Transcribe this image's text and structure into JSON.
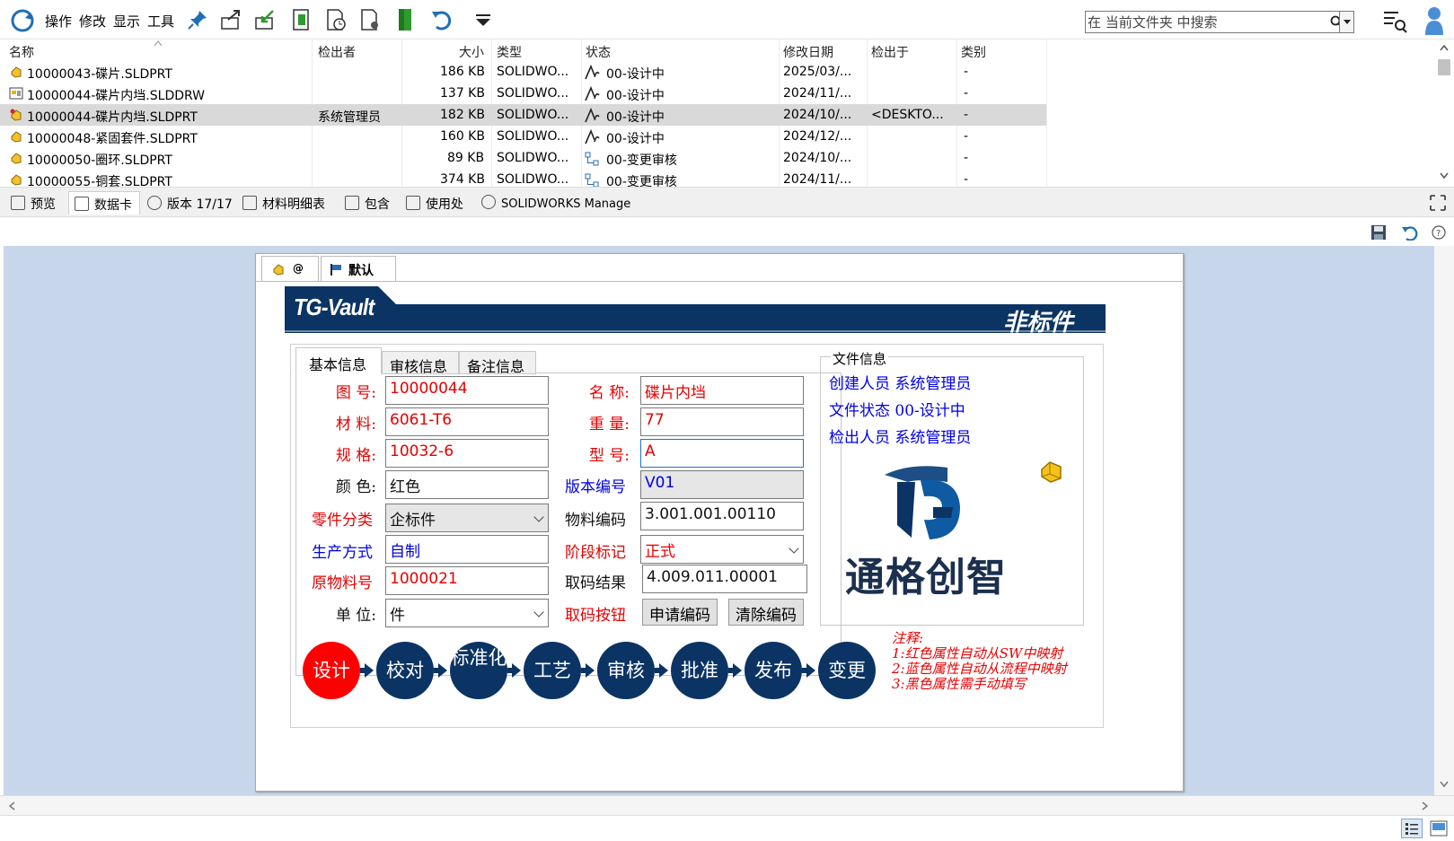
{
  "toolbar": {
    "menus": [
      "操作",
      "修改",
      "显示",
      "工具"
    ],
    "search_placeholder": "在 当前文件夹 中搜索"
  },
  "file_list": {
    "columns": [
      "名称",
      "检出者",
      "大小",
      "类型",
      "状态",
      "修改日期",
      "检出于",
      "类别"
    ],
    "rows": [
      {
        "name": "10000043-碟片.SLDPRT",
        "checked_out_by": "",
        "size": "186 KB",
        "type": "SOLIDWO...",
        "state": "00-设计中",
        "modified": "2025/03/...",
        "checked_out_in": "",
        "category": "-"
      },
      {
        "name": "10000044-碟片内垱.SLDDRW",
        "checked_out_by": "",
        "size": "137 KB",
        "type": "SOLIDWO...",
        "state": "00-设计中",
        "modified": "2024/11/...",
        "checked_out_in": "",
        "category": "-"
      },
      {
        "name": "10000044-碟片内垱.SLDPRT",
        "checked_out_by": "系统管理员",
        "size": "182 KB",
        "type": "SOLIDWO...",
        "state": "00-设计中",
        "modified": "2024/10/...",
        "checked_out_in": "<DESKTO...",
        "category": "-"
      },
      {
        "name": "10000048-紧固套件.SLDPRT",
        "checked_out_by": "",
        "size": "160 KB",
        "type": "SOLIDWO...",
        "state": "00-设计中",
        "modified": "2024/12/...",
        "checked_out_in": "",
        "category": "-"
      },
      {
        "name": "10000050-圈环.SLDPRT",
        "checked_out_by": "",
        "size": "89 KB",
        "type": "SOLIDWO...",
        "state": "00-变更审核",
        "modified": "2024/10/...",
        "checked_out_in": "",
        "category": "-"
      },
      {
        "name": "10000055-铜套.SLDPRT",
        "checked_out_by": "",
        "size": "374 KB",
        "type": "SOLIDWO...",
        "state": "00-变更审核",
        "modified": "2024/11/...",
        "checked_out_in": "",
        "category": "-"
      }
    ]
  },
  "tabs": [
    "预览",
    "数据卡",
    "版本 17/17",
    "材料明细表",
    "包含",
    "使用处",
    "SOLIDWORKS Manage"
  ],
  "card": {
    "top_tabs": [
      "@",
      "默认"
    ],
    "banner_left": "TG-Vault",
    "banner_right": "非标件",
    "inner_tabs": [
      "基本信息",
      "审核信息",
      "备注信息"
    ],
    "fields": {
      "drawing_no": {
        "label": "图 号:",
        "value": "10000044"
      },
      "name": {
        "label": "名 称:",
        "value": "碟片内垱"
      },
      "material": {
        "label": "材 料:",
        "value": "6061-T6"
      },
      "weight": {
        "label": "重 量:",
        "value": "77"
      },
      "spec": {
        "label": "规 格:",
        "value": "10032-6"
      },
      "model": {
        "label": "型 号:",
        "value": "A"
      },
      "color": {
        "label": "颜 色:",
        "value": "红色"
      },
      "version_no": {
        "label": "版本编号",
        "value": "V01"
      },
      "part_category": {
        "label": "零件分类",
        "value": "企标件"
      },
      "material_code": {
        "label": "物料编码",
        "value": "3.001.001.00110"
      },
      "production": {
        "label": "生产方式",
        "value": "自制"
      },
      "stage": {
        "label": "阶段标记",
        "value": "正式"
      },
      "raw_material": {
        "label": "原物料号",
        "value": "1000021"
      },
      "code_result": {
        "label": "取码结果",
        "value": "4.009.011.00001"
      },
      "unit": {
        "label": "单 位:",
        "value": "件"
      },
      "code_button": {
        "label": "取码按钮"
      }
    },
    "buttons": {
      "apply_code": "申请编码",
      "clear_code": "清除编码"
    },
    "file_info": {
      "title": "文件信息",
      "lines": [
        "创建人员 系统管理员",
        "文件状态 00-设计中",
        "检出人员 系统管理员"
      ]
    },
    "logo_text": "通格创智",
    "workflow": [
      "设计",
      "校对",
      "标准化",
      "工艺",
      "审核",
      "批准",
      "发布",
      "变更"
    ],
    "notes": {
      "title": "注释:",
      "line1": "1:红色属性自动从SW中映射",
      "line2": "2:蓝色属性自动从流程中映射",
      "line3": "3:黑色属性需手动填写"
    }
  },
  "colors": {
    "navy": "#0b3464",
    "red_label": "#e60000",
    "blue_label": "#0000e6",
    "content_bg": "#c7d6ea",
    "selected_row": "#d9d9d9"
  }
}
